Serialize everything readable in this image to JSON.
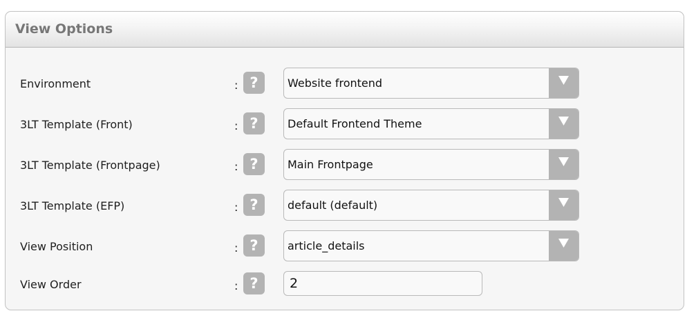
{
  "panel": {
    "title": "View Options"
  },
  "help_glyph": "?",
  "colon": ":",
  "rows": [
    {
      "label": "Environment",
      "value": "Website frontend"
    },
    {
      "label": "3LT Template (Front)",
      "value": "Default Frontend Theme"
    },
    {
      "label": "3LT Template (Frontpage)",
      "value": "Main Frontpage"
    },
    {
      "label": "3LT Template (EFP)",
      "value": "default (default)"
    },
    {
      "label": "View Position",
      "value": "article_details"
    }
  ],
  "view_order": {
    "label": "View Order",
    "value": "2"
  },
  "icons": {
    "help": "question-mark-icon",
    "dropdown": "triangle-down-icon"
  },
  "colors": {
    "panel_bg": "#f6f6f6",
    "button_gray": "#b3b3b3",
    "title_gray": "#777777"
  }
}
